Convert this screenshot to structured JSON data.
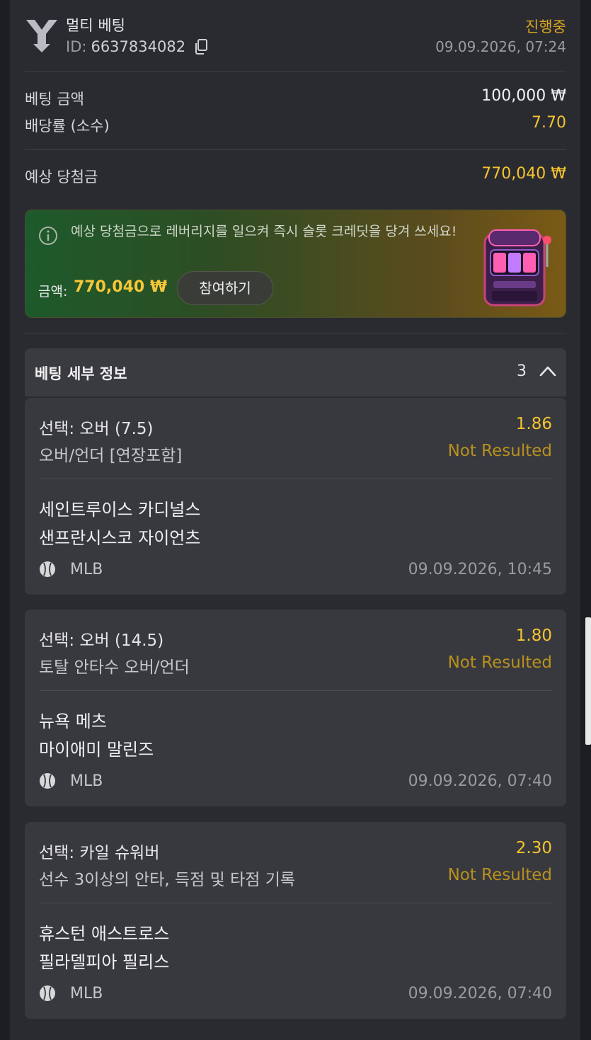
{
  "header": {
    "title": "멀티 베팅",
    "id_label": "ID:",
    "id_value": "6637834082",
    "status": "진행중",
    "datetime": "09.09.2026, 07:24"
  },
  "summary": {
    "stake_label": "베팅 금액",
    "stake_value": "100,000 ₩",
    "odds_label": "배당률 (소수)",
    "odds_value": "7.70",
    "payout_label": "예상 당첨금",
    "payout_value": "770,040 ₩"
  },
  "promo": {
    "text": "예상 당첨금으로 레버리지를 일으켜 즉시 슬롯 크레딧을 당겨 쓰세요!",
    "amount_label": "금액:",
    "amount_value": "770,040 ₩",
    "button_label": "참여하기"
  },
  "details": {
    "title": "베팅 세부 정보",
    "count": "3"
  },
  "bets": [
    {
      "selection": "선택: 오버 (7.5)",
      "market": "오버/언더 [연장포함]",
      "odds": "1.86",
      "status": "Not Resulted",
      "team1": "세인트루이스 카디널스",
      "team2": "샌프란시스코 자이언츠",
      "league": "MLB",
      "datetime": "09.09.2026, 10:45"
    },
    {
      "selection": "선택: 오버 (14.5)",
      "market": "토탈 안타수 오버/언더",
      "odds": "1.80",
      "status": "Not Resulted",
      "team1": "뉴욕 메츠",
      "team2": "마이애미 말린즈",
      "league": "MLB",
      "datetime": "09.09.2026, 07:40"
    },
    {
      "selection": "선택: 카일 슈워버",
      "market": "선수 3이상의 안타, 득점 및 타점 기록",
      "odds": "2.30",
      "status": "Not Resulted",
      "team1": "휴스턴 애스트로스",
      "team2": "필라델피아 필리스",
      "league": "MLB",
      "datetime": "09.09.2026, 07:40"
    }
  ],
  "colors": {
    "accent_yellow": "#f4c430",
    "status_orange": "#d9a520",
    "background": "#2a2b30"
  },
  "icons": {
    "logo": "brand-logo-icon",
    "copy": "copy-icon",
    "info": "info-icon",
    "chevron": "chevron-up-icon",
    "sport": "baseball-icon",
    "promo_image": "slot-machine-icon"
  }
}
